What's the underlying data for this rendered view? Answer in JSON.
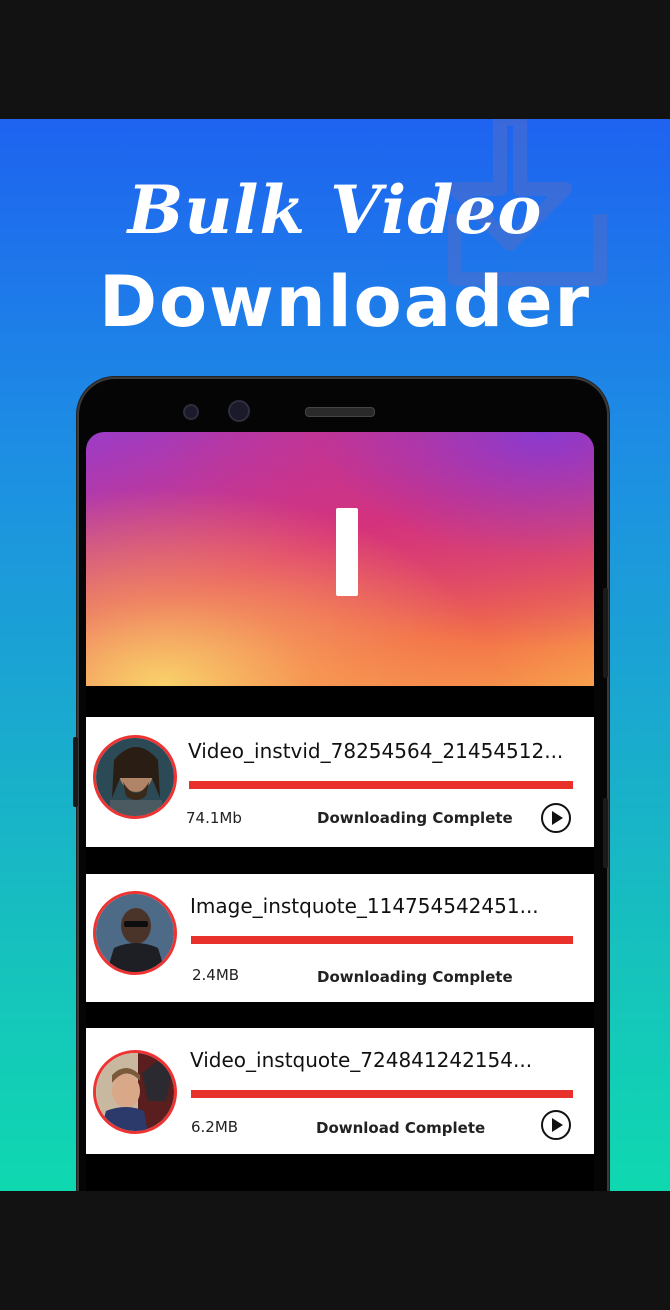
{
  "banner": {
    "title_line1": "Bulk Video",
    "title_line2": "Downloader",
    "gradient_top": "#1e63f0",
    "gradient_bottom": "#0fd8b0"
  },
  "app": {
    "hero_icon": "letter-I-logo",
    "accent_color": "#e8312a"
  },
  "downloads": [
    {
      "name": "Video_instvid_78254564_21454512...",
      "size": "74.1Mb",
      "status": "Downloading Complete",
      "progress": 1.0,
      "has_play": true
    },
    {
      "name": "Image_instquote_114754542451...",
      "size": "2.4MB",
      "status": "Downloading Complete",
      "progress": 1.0,
      "has_play": false
    },
    {
      "name": "Video_instquote_724841242154...",
      "size": "6.2MB",
      "status": "Download Complete",
      "progress": 1.0,
      "has_play": true
    }
  ]
}
